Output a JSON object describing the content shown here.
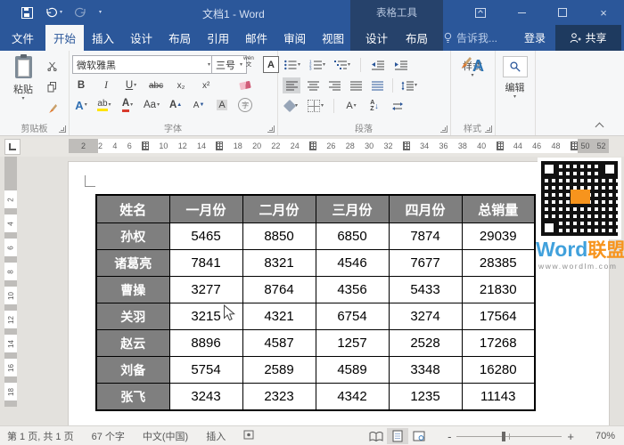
{
  "titlebar": {
    "title": "文档1 - Word",
    "context_header": "表格工具"
  },
  "tabs": {
    "file": "文件",
    "main": [
      "开始",
      "插入",
      "设计",
      "布局",
      "引用",
      "邮件",
      "审阅",
      "视图"
    ],
    "active": "开始",
    "contextual": [
      "设计",
      "布局"
    ],
    "tell_me": "告诉我...",
    "sign_in": "登录",
    "share": "共享"
  },
  "ribbon": {
    "paste": "粘贴",
    "clipboard_group": "剪贴板",
    "font_name": "微软雅黑",
    "font_size": "三号",
    "phonetic_top": "wén",
    "phonetic_bottom": "文",
    "char_border": "A",
    "bold": "B",
    "italic": "I",
    "underline": "U",
    "strikethrough": "abc",
    "subscript": "x₂",
    "superscript": "x²",
    "text_effects": "A",
    "highlight": "ab",
    "font_color": "A",
    "change_case": "Aa",
    "grow_font": "A",
    "shrink_font": "A",
    "char_shading": "A",
    "enclose_char": "字",
    "font_group": "字体",
    "sort_a": "A",
    "sort_z": "Z",
    "asian_layout": "A",
    "paragraph_group": "段落",
    "styles_button": "样式",
    "styles_group": "样式",
    "editing_button": "编辑"
  },
  "ruler": {
    "left_margin_label": "2",
    "marks": [
      "2",
      "4",
      "6",
      "#",
      "10",
      "12",
      "14",
      "#",
      "18",
      "20",
      "22",
      "24",
      "#",
      "26",
      "28",
      "30",
      "32",
      "#",
      "34",
      "36",
      "38",
      "40",
      "#",
      "44",
      "46",
      "48",
      "#"
    ],
    "right_margin_labels": [
      "50",
      "52"
    ],
    "vertical_marks": [
      "2",
      "4",
      "6",
      "8",
      "10",
      "12",
      "14",
      "16",
      "18"
    ]
  },
  "document": {
    "table": {
      "headers": [
        "姓名",
        "一月份",
        "二月份",
        "三月份",
        "四月份",
        "总销量"
      ],
      "rows": [
        [
          "孙权",
          "5465",
          "8850",
          "6850",
          "7874",
          "29039"
        ],
        [
          "诸葛亮",
          "7841",
          "8321",
          "4546",
          "7677",
          "28385"
        ],
        [
          "曹操",
          "3277",
          "8764",
          "4356",
          "5433",
          "21830"
        ],
        [
          "关羽",
          "3215",
          "4321",
          "6754",
          "3274",
          "17564"
        ],
        [
          "赵云",
          "8896",
          "4587",
          "1257",
          "2528",
          "17268"
        ],
        [
          "刘备",
          "5754",
          "2589",
          "4589",
          "3348",
          "16280"
        ],
        [
          "张飞",
          "3243",
          "2323",
          "4342",
          "1235",
          "11143"
        ]
      ]
    },
    "watermark": {
      "brand_en": "Word",
      "brand_cn": "联盟",
      "url": "www.wordlm.com"
    }
  },
  "statusbar": {
    "page_info": "第 1 页, 共 1 页",
    "word_count": "67 个字",
    "language": "中文(中国)",
    "insert_mode": "插入",
    "zoom_minus": "-",
    "zoom_plus": "+",
    "zoom_level": "70%"
  },
  "colors": {
    "accent": "#2b579a",
    "contextual_header": "#26426b",
    "share_button": "#1e3a5f",
    "table_header_bg": "#7f7f7f",
    "brand_blue": "#41a1dc",
    "brand_orange": "#f7941d"
  }
}
